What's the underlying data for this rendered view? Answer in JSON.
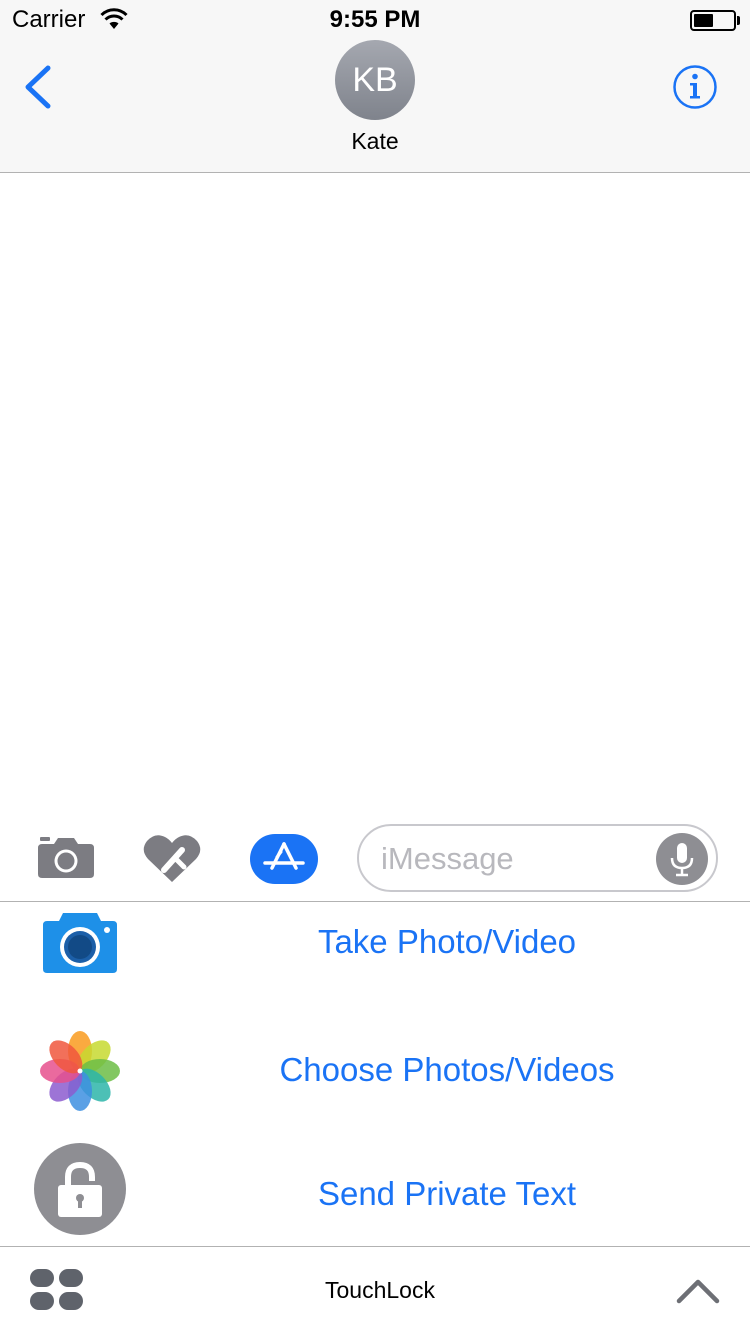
{
  "status_bar": {
    "carrier": "Carrier",
    "time": "9:55 PM",
    "battery_level": 0.5
  },
  "header": {
    "avatar_initials": "KB",
    "contact_name": "Kate",
    "back_icon": "chevron-left-icon",
    "info_icon": "info-icon"
  },
  "input_bar": {
    "message_placeholder": "iMessage",
    "message_value": "",
    "icons": [
      "camera-icon",
      "digital-touch-heart-icon",
      "app-store-icon",
      "microphone-icon"
    ]
  },
  "actions": [
    {
      "label": "Take Photo/Video",
      "icon": "camera-app-icon"
    },
    {
      "label": "Choose Photos/Videos",
      "icon": "photos-app-icon"
    },
    {
      "label": "Send Private Text",
      "icon": "lock-icon"
    }
  ],
  "app_bar": {
    "app_name": "TouchLock",
    "drawer_icon": "app-drawer-icon",
    "expand_icon": "chevron-up-icon"
  },
  "colors": {
    "accent": "#1a73f5",
    "icon_gray": "#8e8e93",
    "header_bg": "#f7f7f7",
    "separator": "#b2b2b2"
  }
}
